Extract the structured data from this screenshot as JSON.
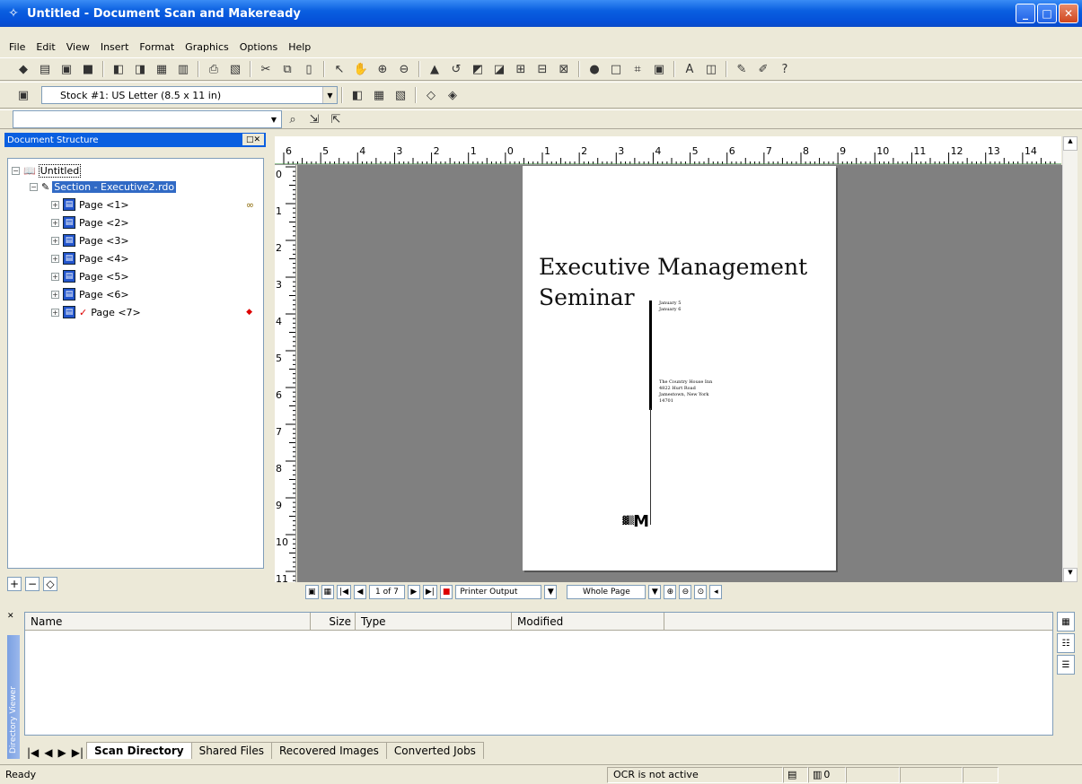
{
  "window": {
    "title": "Untitled - Document Scan and Makeready",
    "min": "_",
    "max": "□",
    "close": "✕"
  },
  "menu": [
    {
      "label": "File"
    },
    {
      "label": "Edit"
    },
    {
      "label": "View"
    },
    {
      "label": "Insert"
    },
    {
      "label": "Format"
    },
    {
      "label": "Graphics"
    },
    {
      "label": "Options"
    },
    {
      "label": "Help"
    }
  ],
  "stock_combo": {
    "value": "Stock #1: US Letter (8.5 x 11 in)"
  },
  "doc_structure": {
    "title": "Document Structure",
    "root": "Untitled",
    "section": "Section - Executive2.rdo",
    "pages": [
      "Page <1>",
      "Page <2>",
      "Page <3>",
      "Page <4>",
      "Page <5>",
      "Page <6>",
      "Page <7>"
    ]
  },
  "ruler": {
    "h_labels": [
      "6",
      "5",
      "4",
      "3",
      "2",
      "1",
      "0",
      "1",
      "2",
      "3",
      "4",
      "5",
      "6",
      "7",
      "8",
      "9",
      "10",
      "11",
      "12",
      "13",
      "14"
    ],
    "v_labels": [
      "0",
      "1",
      "2",
      "3",
      "4",
      "5",
      "6",
      "7",
      "8",
      "9",
      "10",
      "11"
    ]
  },
  "document_page": {
    "heading_line1": "Executive Management",
    "heading_line2": "Seminar",
    "date1": "January 5",
    "date2": "January 6",
    "addr1": "The Country House Inn",
    "addr2": "4822 Hurt Road",
    "addr3": "Jamestown, New York",
    "addr4": "14701",
    "logo": "M"
  },
  "navigation": {
    "page_indicator": "1 of 7",
    "output_mode": "Printer Output",
    "zoom_mode": "Whole Page"
  },
  "directory_viewer": {
    "side_label": "Directory Viewer",
    "columns": [
      "Name",
      "Size",
      "Type",
      "Modified"
    ],
    "tabs": [
      "Scan Directory",
      "Shared Files",
      "Recovered Images",
      "Converted Jobs"
    ]
  },
  "status": {
    "ready": "Ready",
    "ocr": "OCR is not active",
    "count": "0"
  }
}
